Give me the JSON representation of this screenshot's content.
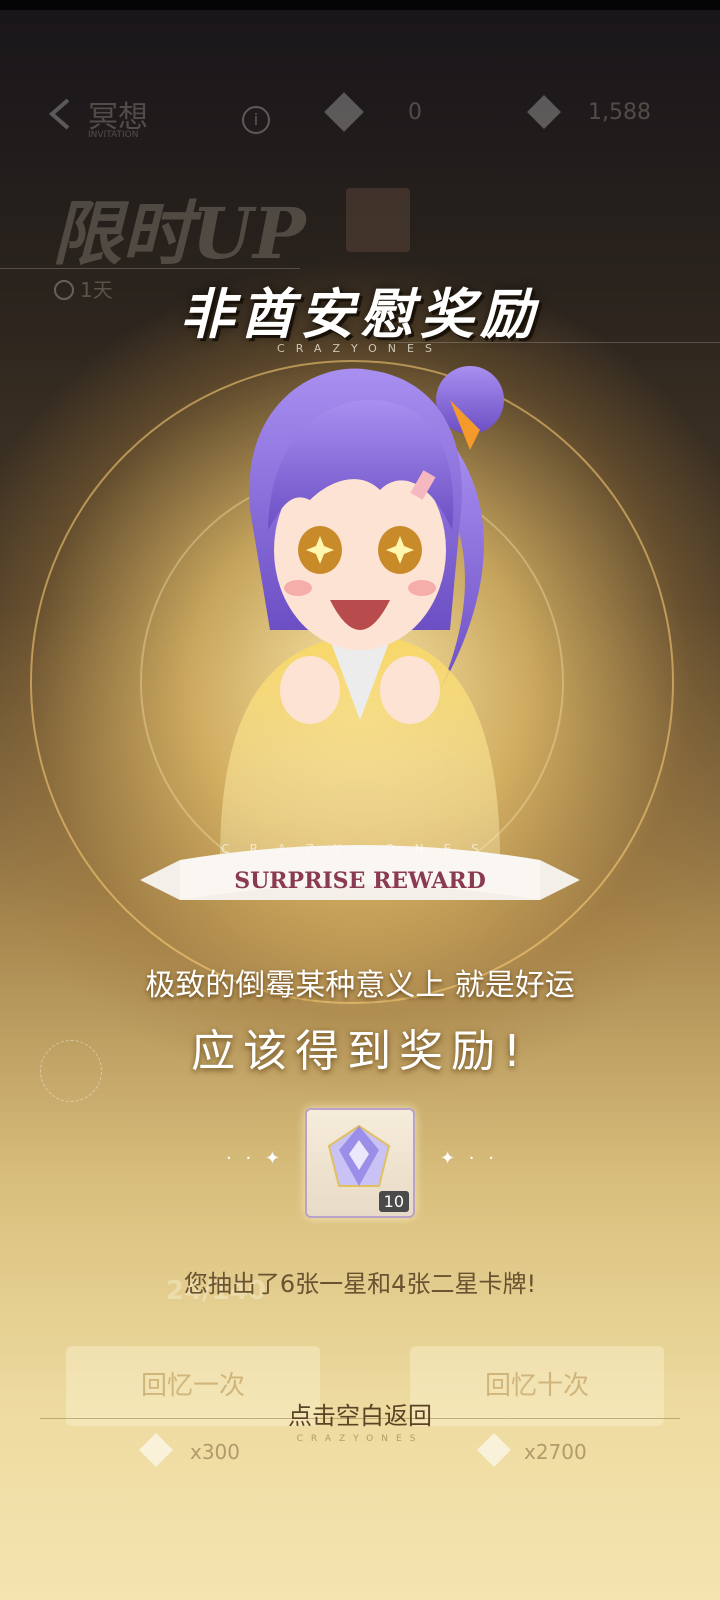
{
  "header": {
    "back_label": "冥想",
    "back_sub": "INVITATION",
    "currency1_amount": "0",
    "currency2_amount": "1,588"
  },
  "banner": {
    "title": "限时UP",
    "timer": "1天"
  },
  "reward": {
    "title": "非酋安慰奖励",
    "brand": "CRAZYONES",
    "ribbon_brand": "CRAZY ONES",
    "ribbon": "SURPRISE REWARD",
    "message_line1": "极致的倒霉某种意义上 就是好运",
    "message_line2": "应该得到奖励!",
    "item_count": "10",
    "result_text": "您抽出了6张一星和4张二星卡牌!",
    "return_hint": "点击空白返回"
  },
  "bottom": {
    "progress": "24/140",
    "pull_one_label": "回忆一次",
    "pull_ten_label": "回忆十次",
    "brand": "CRAZYONES",
    "cost_one": "x300",
    "cost_ten": "x2700"
  },
  "colors": {
    "gold": "#e8c77a",
    "ribbon_text": "#8a3a52",
    "hair": "#8a6ad8",
    "jacket": "#f3c84a"
  }
}
